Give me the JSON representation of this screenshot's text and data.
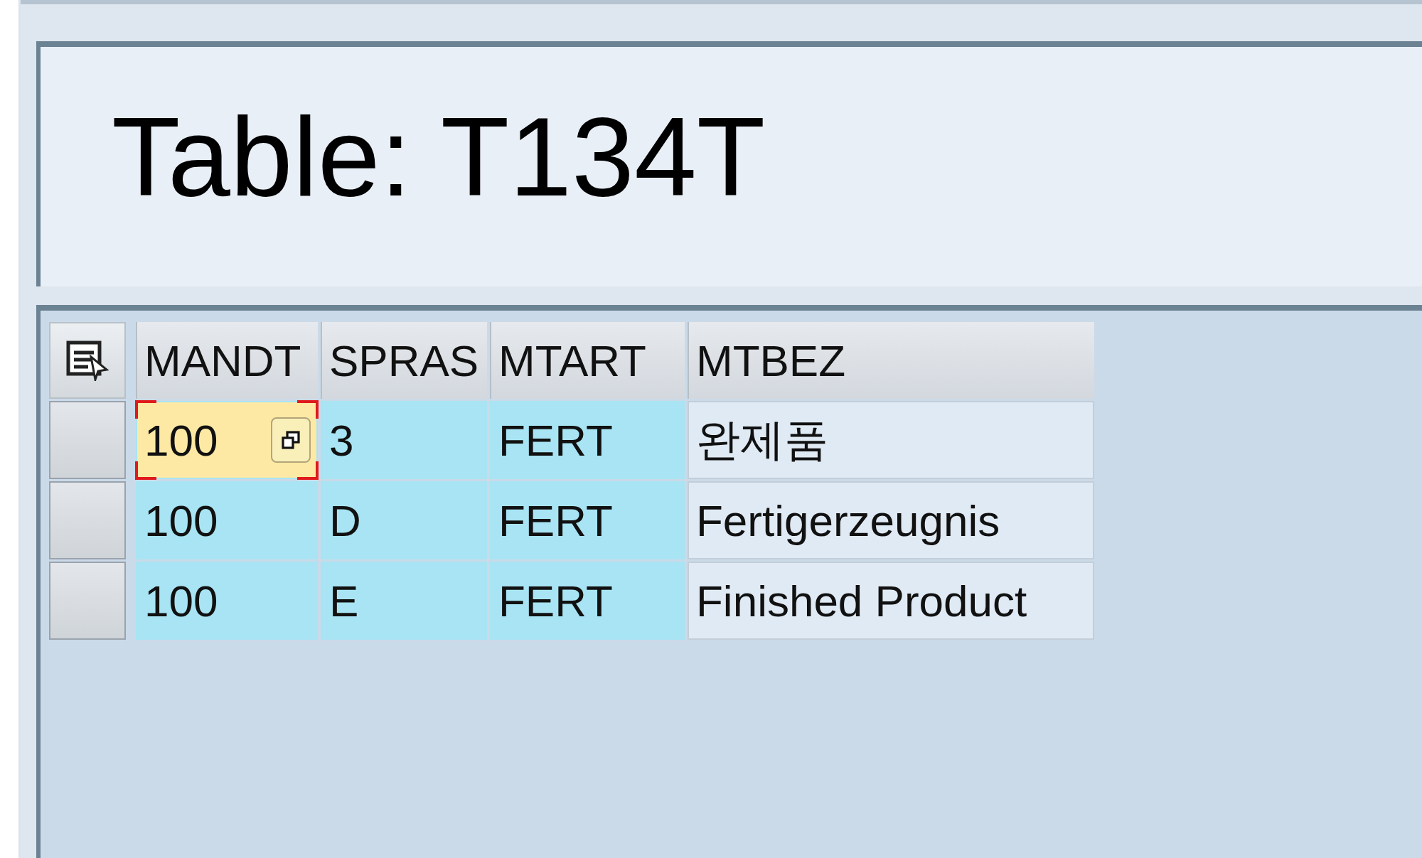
{
  "header": {
    "title": "Table: T134T"
  },
  "table": {
    "columns": [
      {
        "label": "MANDT",
        "key": true
      },
      {
        "label": "SPRAS",
        "key": true
      },
      {
        "label": "MTART",
        "key": true
      },
      {
        "label": "MTBEZ",
        "key": false
      }
    ],
    "rows": [
      {
        "selected": false,
        "cells": [
          {
            "text": "100",
            "focused": true
          },
          {
            "text": "3",
            "focused": false
          },
          {
            "text": "FERT",
            "focused": false
          },
          {
            "text": "완제품",
            "focused": false
          }
        ]
      },
      {
        "selected": false,
        "cells": [
          {
            "text": "100",
            "focused": false
          },
          {
            "text": "D",
            "focused": false
          },
          {
            "text": "FERT",
            "focused": false
          },
          {
            "text": "Fertigerzeugnis",
            "focused": false
          }
        ]
      },
      {
        "selected": false,
        "cells": [
          {
            "text": "100",
            "focused": false
          },
          {
            "text": "E",
            "focused": false
          },
          {
            "text": "FERT",
            "focused": false
          },
          {
            "text": "Finished Product",
            "focused": false
          }
        ]
      }
    ]
  }
}
